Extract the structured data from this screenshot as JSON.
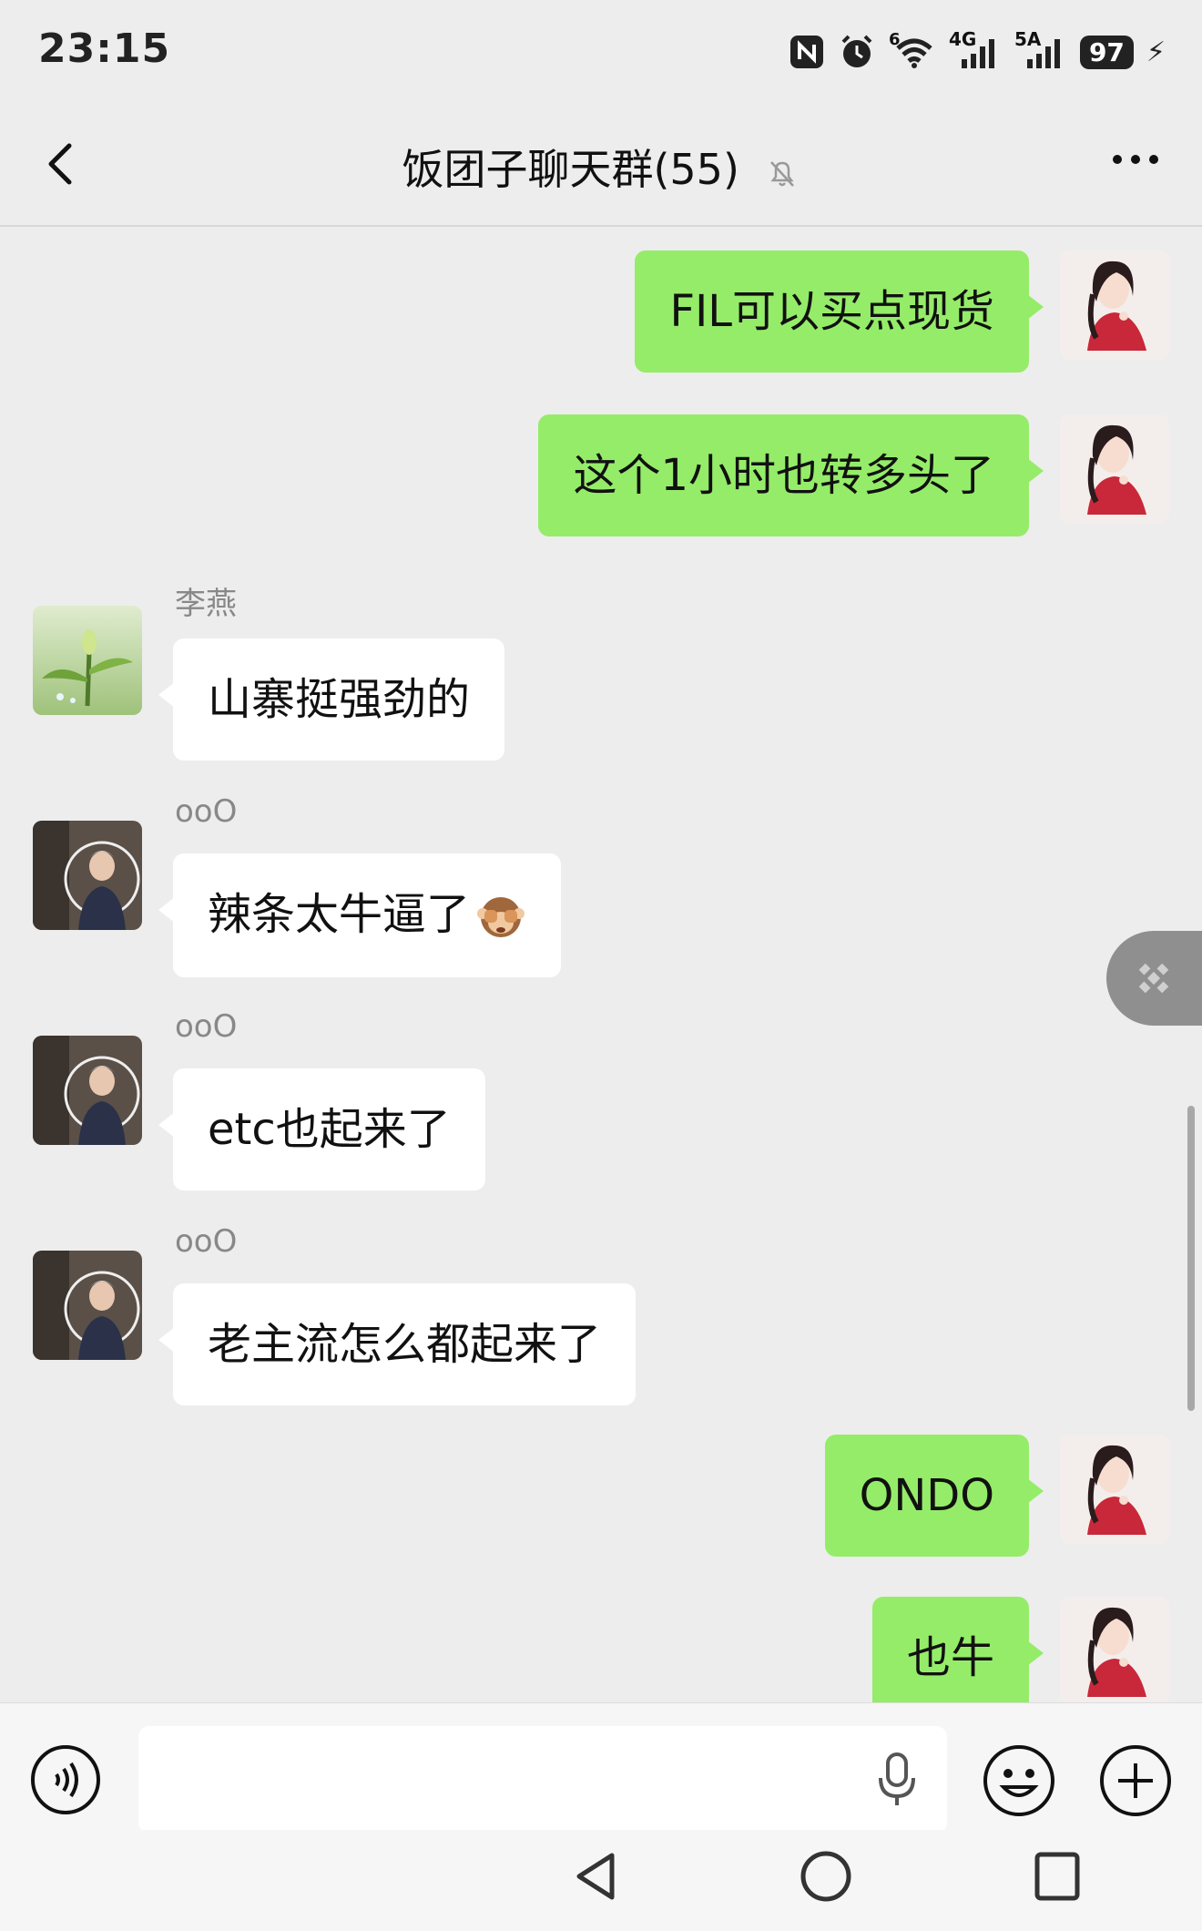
{
  "status_bar": {
    "time": "23:15",
    "network_6": "6",
    "network_4g": "4G",
    "network_5a": "5A",
    "battery": "97"
  },
  "header": {
    "title": "饭团子聊天群(55)",
    "icons": [
      "back-icon",
      "mute-bell-icon",
      "more-icon"
    ]
  },
  "messages": [
    {
      "side": "me",
      "text": "FIL可以买点现货"
    },
    {
      "side": "me",
      "text": "这个1小时也转多头了"
    },
    {
      "side": "other",
      "sender": "李燕",
      "text": "山寨挺强劲的"
    },
    {
      "side": "other",
      "sender": "ooO",
      "text": "辣条太牛逼了",
      "emoji": "see-no-evil-monkey"
    },
    {
      "side": "other",
      "sender": "ooO",
      "text": "etc也起来了"
    },
    {
      "side": "other",
      "sender": "ooO",
      "text": "老主流怎么都起来了"
    },
    {
      "side": "me",
      "text": "ONDO"
    },
    {
      "side": "me",
      "text": "也牛"
    }
  ],
  "input_bar": {
    "placeholder": "",
    "icons": [
      "voice-icon",
      "mic-icon",
      "emoji-icon",
      "plus-icon"
    ]
  },
  "colors": {
    "background": "#ededed",
    "my_bubble": "#95ec69",
    "other_bubble": "#ffffff",
    "sender_name": "#888888"
  }
}
